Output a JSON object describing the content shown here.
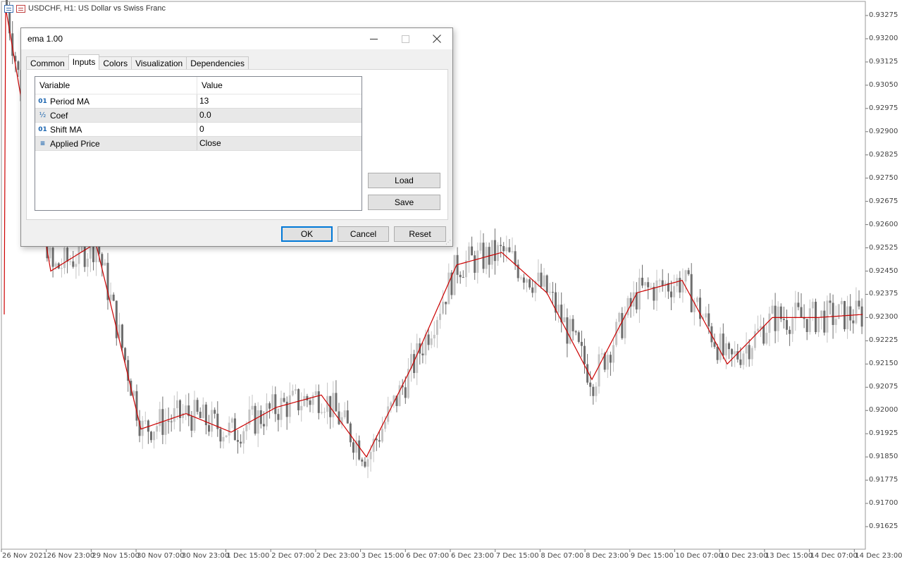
{
  "chart": {
    "title": "USDCHF, H1:  US Dollar vs Swiss Franc",
    "price_labels": [
      "0.93275",
      "0.93200",
      "0.93125",
      "0.93050",
      "0.92975",
      "0.92900",
      "0.92825",
      "0.92750",
      "0.92675",
      "0.92600",
      "0.92525",
      "0.92450",
      "0.92375",
      "0.92300",
      "0.92225",
      "0.92150",
      "0.92075",
      "0.92000",
      "0.91925",
      "0.91850",
      "0.91775",
      "0.91700",
      "0.91625"
    ],
    "time_labels": [
      "26 Nov 2021",
      "26 Nov 23:00",
      "29 Nov 15:00",
      "30 Nov 07:00",
      "30 Nov 23:00",
      "1 Dec 15:00",
      "2 Dec 07:00",
      "2 Dec 23:00",
      "3 Dec 15:00",
      "6 Dec 07:00",
      "6 Dec 23:00",
      "7 Dec 15:00",
      "8 Dec 07:00",
      "8 Dec 23:00",
      "9 Dec 15:00",
      "10 Dec 07:00",
      "10 Dec 23:00",
      "13 Dec 15:00",
      "14 Dec 07:00",
      "14 Dec 23:00"
    ],
    "colors": {
      "candle": "#9a9a9a",
      "ema": "#cc0000",
      "grid_axis": "#cfcfcf"
    }
  },
  "chart_data": {
    "type": "line",
    "title": "USDCHF, H1:  US Dollar vs Swiss Franc",
    "xlabel": "",
    "ylabel": "",
    "ylim": [
      0.91625,
      0.93275
    ],
    "grid": false,
    "series": [
      {
        "x": [
          "26 Nov 2021",
          "26 Nov 23:00",
          "29 Nov 15:00",
          "30 Nov 07:00",
          "30 Nov 23:00",
          "1 Dec 15:00",
          "2 Dec 07:00",
          "2 Dec 23:00",
          "3 Dec 15:00",
          "6 Dec 07:00",
          "6 Dec 23:00",
          "7 Dec 15:00",
          "8 Dec 07:00",
          "8 Dec 23:00",
          "9 Dec 15:00",
          "10 Dec 07:00",
          "10 Dec 23:00",
          "13 Dec 15:00",
          "14 Dec 07:00",
          "14 Dec 23:00"
        ],
        "values": [
          0.933,
          0.9245,
          0.9254,
          0.9194,
          0.9199,
          0.9193,
          0.9201,
          0.9205,
          0.9185,
          0.9214,
          0.9247,
          0.9251,
          0.9238,
          0.921,
          0.9238,
          0.9242,
          0.9215,
          0.923,
          0.923,
          0.9231
        ]
      }
    ]
  },
  "dialog": {
    "title": "ema 1.00",
    "tabs": [
      "Common",
      "Inputs",
      "Colors",
      "Visualization",
      "Dependencies"
    ],
    "active_tab": "Inputs",
    "headers": {
      "variable": "Variable",
      "value": "Value"
    },
    "rows": [
      {
        "icon": "01",
        "variable": "Period MA",
        "value": "13"
      },
      {
        "icon": "½",
        "variable": "Coef",
        "value": "0.0"
      },
      {
        "icon": "01",
        "variable": "Shift MA",
        "value": "0"
      },
      {
        "icon": "≡",
        "variable": "Applied Price",
        "value": "Close"
      }
    ],
    "load": "Load",
    "save": "Save",
    "ok": "OK",
    "cancel": "Cancel",
    "reset": "Reset"
  }
}
